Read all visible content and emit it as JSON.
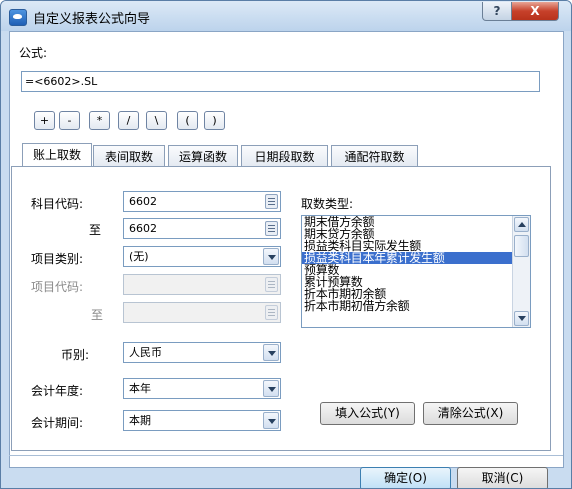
{
  "window": {
    "title": "自定义报表公式向导",
    "help_label": "?",
    "close_label": "X"
  },
  "formula": {
    "label": "公式:",
    "value": "=<6602>.SL"
  },
  "operators": [
    "+",
    "-",
    "*",
    "/",
    "\\",
    "(",
    ")"
  ],
  "tabs": [
    "账上取数",
    "表间取数",
    "运算函数",
    "日期段取数",
    "通配符取数"
  ],
  "active_tab": "账上取数",
  "form": {
    "subject_code_label": "科目代码:",
    "subject_code_value": "6602",
    "to_label": "至",
    "subject_code_to_value": "6602",
    "item_type_label": "项目类别:",
    "item_type_value": "(无)",
    "item_code_label": "项目代码:",
    "item_code_value": "",
    "item_to_label": "至",
    "item_code_to_value": "",
    "currency_label": "币别:",
    "currency_value": "人民币",
    "year_label": "会计年度:",
    "year_value": "本年",
    "period_label": "会计期间:",
    "period_value": "本期"
  },
  "fetch_type": {
    "label": "取数类型:",
    "items": [
      "期末借方余额",
      "期末贷方余额",
      "损益类科目实际发生额",
      "损益类科目本年累计发生额",
      "预算数",
      "累计预算数",
      "折本市期初余额",
      "折本市期初借方余额"
    ],
    "selected_index": 3
  },
  "buttons": {
    "fill_formula": "填入公式(Y)",
    "clear_formula": "清除公式(X)",
    "ok": "确定(O)",
    "cancel": "取消(C)"
  },
  "colors": {
    "selection": "#3b6fcd",
    "titlebar": "#bcd3ec",
    "close": "#c7412b"
  }
}
